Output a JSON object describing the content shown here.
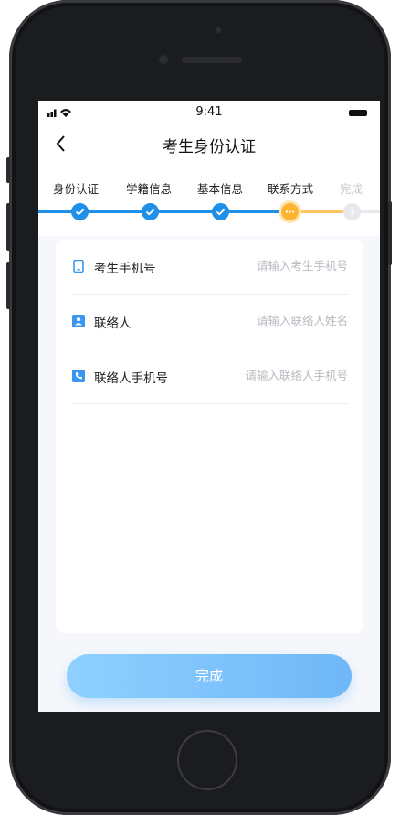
{
  "status_bar": {
    "time": "9:41"
  },
  "nav": {
    "title": "考生身份认证",
    "back_icon": "chevron-left-icon"
  },
  "steps": [
    {
      "label": "身份认证",
      "state": "done"
    },
    {
      "label": "学籍信息",
      "state": "done"
    },
    {
      "label": "基本信息",
      "state": "done"
    },
    {
      "label": "联系方式",
      "state": "active"
    },
    {
      "label": "完成",
      "state": "todo"
    }
  ],
  "form": {
    "fields": [
      {
        "label": "考生手机号",
        "placeholder": "请输入考生手机号",
        "value": "",
        "icon": "phone-icon"
      },
      {
        "label": "联络人",
        "placeholder": "请输入联络人姓名",
        "value": "",
        "icon": "contact-card-icon"
      },
      {
        "label": "联络人手机号",
        "placeholder": "请输入联络人手机号",
        "value": "",
        "icon": "call-icon"
      }
    ]
  },
  "submit_label": "完成",
  "colors": {
    "accent": "#1f8fe8",
    "active_step": "#fdb432",
    "button_start": "#8ed0ff",
    "button_end": "#6fb7f7"
  }
}
